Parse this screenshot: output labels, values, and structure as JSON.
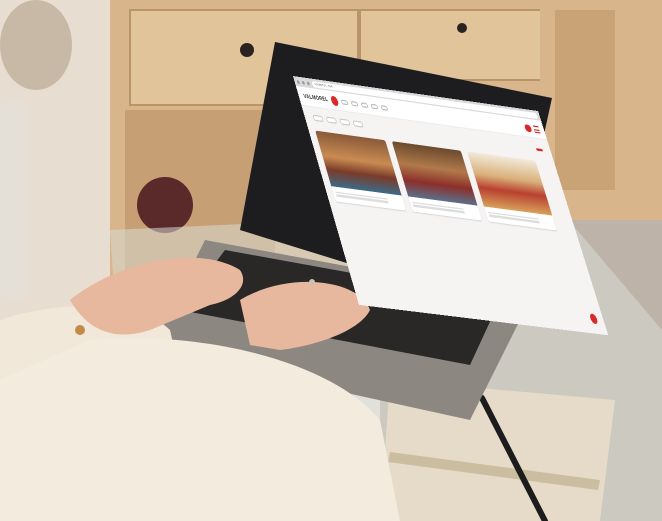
{
  "scene": {
    "description_free": true
  },
  "website": {
    "url": "valmorel.com",
    "brand": "VALMOREL",
    "nav_items": [
      "",
      "",
      "",
      "",
      ""
    ],
    "header_button": "",
    "filters": [
      "",
      "",
      "",
      ""
    ],
    "search_button": "",
    "cards": [
      {
        "title": ""
      },
      {
        "title": ""
      },
      {
        "title": ""
      }
    ]
  },
  "colors": {
    "accent": "#d9292b",
    "wood": "#d8b48b",
    "laptop_body": "#8d8782",
    "screen_background": "#f6f3f3",
    "sweater": "#efe6d8"
  }
}
